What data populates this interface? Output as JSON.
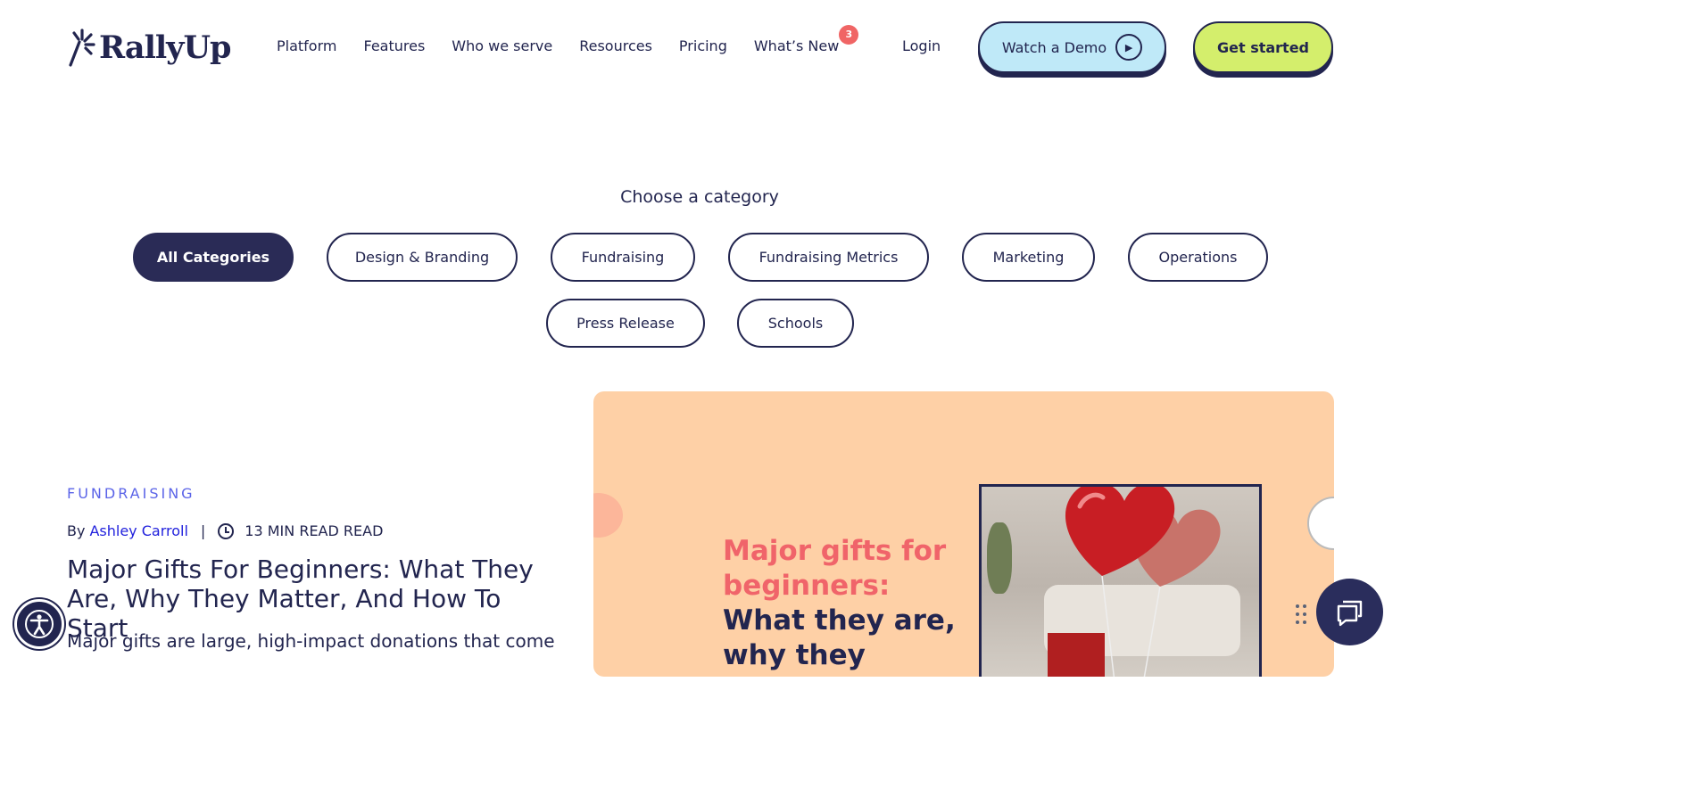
{
  "header": {
    "brand": "RallyUp",
    "nav": [
      "Platform",
      "Features",
      "Who we serve",
      "Resources",
      "Pricing",
      "What’s New"
    ],
    "whats_new_badge": "3",
    "login": "Login",
    "watch_demo": "Watch a Demo",
    "get_started": "Get started"
  },
  "categories": {
    "heading": "Choose a category",
    "items": [
      "All Categories",
      "Design & Branding",
      "Fundraising",
      "Fundraising Metrics",
      "Marketing",
      "Operations",
      "Press Release",
      "Schools"
    ],
    "active": "All Categories"
  },
  "article": {
    "category": "FUNDRAISING",
    "by": "By",
    "author": "Ashley Carroll",
    "separator": "|",
    "read_time": "13 MIN READ READ",
    "title": "Major Gifts For Beginners: What They Are, Why They Matter, And How To Start",
    "excerpt": "Major gifts are large, high-impact donations that come"
  },
  "hero": {
    "accent_text": "Major gifts for beginners:",
    "main_text": "What they are, why they matter, and"
  },
  "colors": {
    "navy": "#22254f",
    "demo_button": "#bfe9f8",
    "start_button": "#d4ee6c",
    "hero_bg": "#fed0a6",
    "accent_coral": "#f0646a",
    "kicker": "#5b64e8",
    "badge": "#f06565"
  },
  "icons": {
    "logo": "spark-icon",
    "demo": "play-icon",
    "readtime": "clock-icon",
    "accessibility": "accessibility-icon",
    "chat": "chat-icon",
    "chat_handle": "drag-handle-icon"
  }
}
